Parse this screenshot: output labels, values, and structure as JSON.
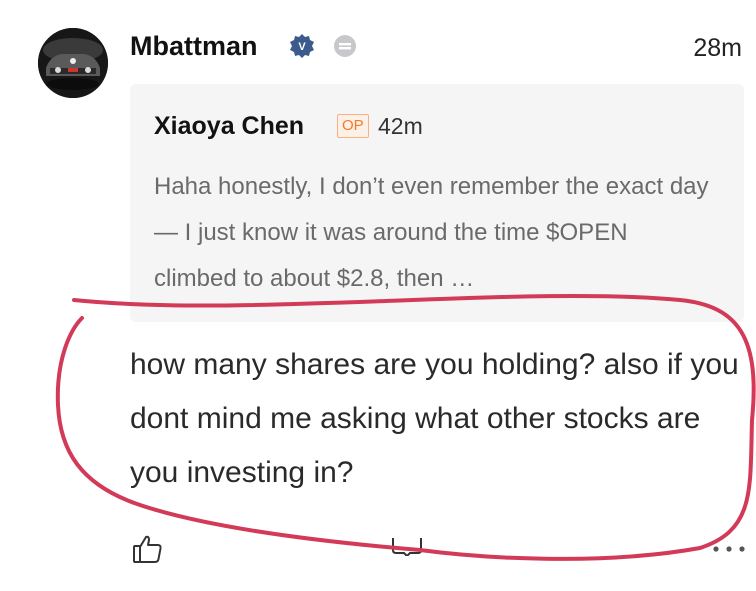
{
  "comment": {
    "author": "Mbattman",
    "time": "28m",
    "text": "how many shares are you holding? also if you dont mind me asking what other stocks are you investing in?"
  },
  "quote": {
    "author": "Xiaoya Chen",
    "badge": "OP",
    "time": "42m",
    "text": "Haha honestly, I don’t even remember the exact day — I just know it was around the time $OPEN climbed to about $2.8, then …"
  },
  "icons": {
    "verified": "verified-badge-icon",
    "level": "level-badge-icon",
    "like": "thumbs-up-icon",
    "reply": "comment-icon",
    "more": "more-dots-icon"
  },
  "colors": {
    "annotation": "#d23a58",
    "op_badge": "#f27a2b",
    "verified": "#3b5b8c"
  }
}
